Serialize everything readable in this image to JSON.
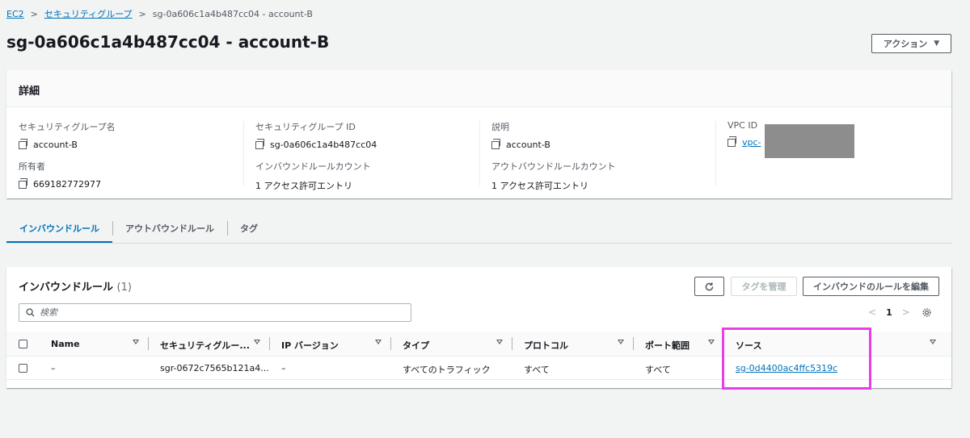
{
  "breadcrumb": {
    "items": [
      "EC2",
      "セキュリティグループ"
    ],
    "current": "sg-0a606c1a4b487cc04 - account-B"
  },
  "page": {
    "title": "sg-0a606c1a4b487cc04 - account-B",
    "actions_label": "アクション"
  },
  "details": {
    "heading": "詳細",
    "fields": [
      {
        "label": "セキュリティグループ名",
        "value": "account-B"
      },
      {
        "label": "セキュリティグループ ID",
        "value": "sg-0a606c1a4b487cc04"
      },
      {
        "label": "説明",
        "value": "account-B"
      },
      {
        "label": "VPC ID",
        "value": "vpc-"
      },
      {
        "label": "所有者",
        "value": "669182772977"
      },
      {
        "label": "インバウンドルールカウント",
        "value": "1 アクセス許可エントリ"
      },
      {
        "label": "アウトバウンドルールカウント",
        "value": "1 アクセス許可エントリ"
      }
    ]
  },
  "tabs": [
    "インバウンドルール",
    "アウトバウンドルール",
    "タグ"
  ],
  "rules": {
    "title": "インバウンドルール",
    "count": "(1)",
    "manage_tags_label": "タグを管理",
    "edit_label": "インバウンドのルールを編集",
    "search_placeholder": "検索",
    "page": "1",
    "columns": [
      "Name",
      "セキュリティグルー...",
      "IP バージョン",
      "タイプ",
      "プロトコル",
      "ポート範囲",
      "ソース"
    ],
    "row": {
      "name": "–",
      "rule_id": "sgr-0672c7565b121a4...",
      "ip_version": "–",
      "type": "すべてのトラフィック",
      "protocol": "すべて",
      "port_range": "すべて",
      "source": "sg-0d4400ac4ffc5319c"
    }
  },
  "colors": {
    "link": "#0073bb",
    "highlight": "#e83ee8",
    "redaction": "#8d8d8d"
  }
}
